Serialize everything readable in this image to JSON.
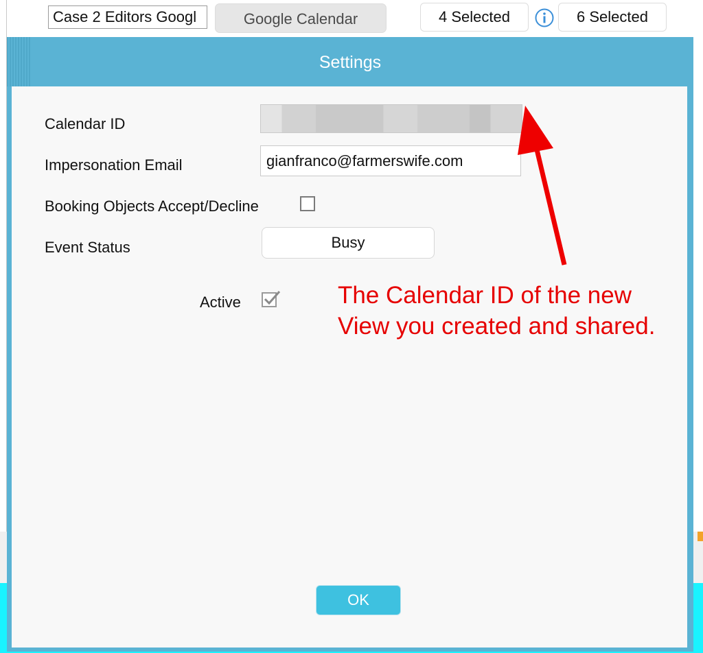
{
  "toolbar": {
    "name_field_value": "Case 2 Editors Googl",
    "calendar_button_label": "Google Calendar",
    "selected_left_label": "4 Selected",
    "info_icon": "info-circle-icon",
    "selected_right_label": "6 Selected"
  },
  "dialog": {
    "title": "Settings",
    "calendar_id_label": "Calendar ID",
    "calendar_id_value": "",
    "impersonation_email_label": "Impersonation Email",
    "impersonation_email_value": "gianfranco@farmerswife.com",
    "booking_objects_label": "Booking Objects Accept/Decline",
    "booking_objects_checked": false,
    "event_status_label": "Event Status",
    "event_status_value": "Busy",
    "active_label": "Active",
    "active_checked": true,
    "ok_label": "OK"
  },
  "annotation": {
    "text": "The Calendar ID of the new View you created and shared.",
    "color": "#e60000"
  },
  "colors": {
    "dialog_frame": "#5ab3d4",
    "ok_button": "#3ec1e0",
    "background_strip": "#19f3ff"
  }
}
